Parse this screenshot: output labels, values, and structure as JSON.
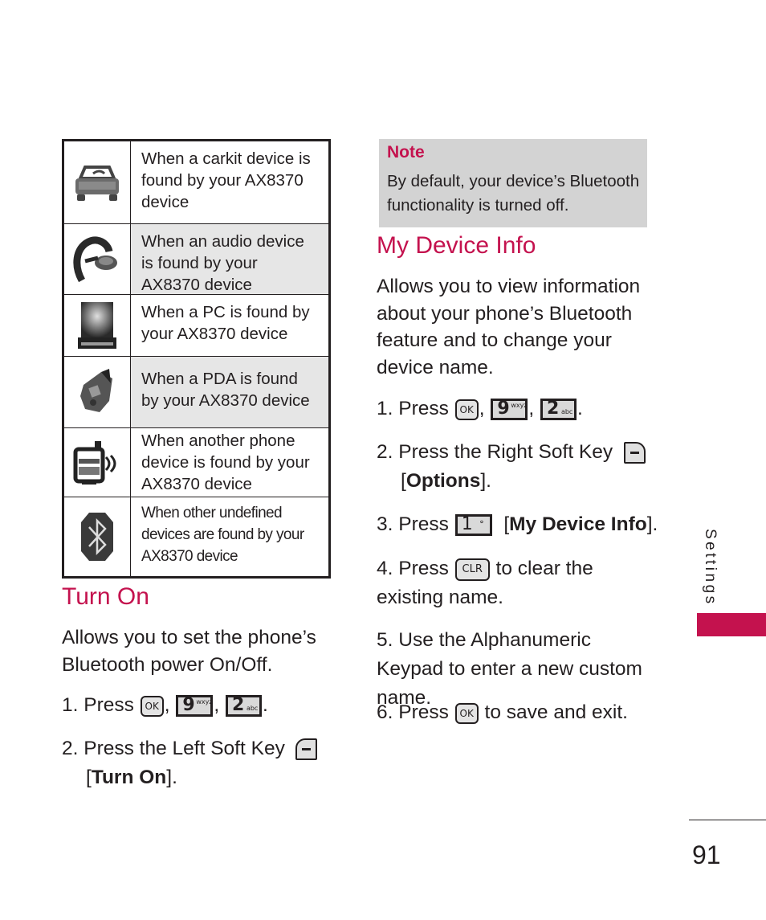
{
  "device_table": {
    "rows": [
      {
        "icon": "carkit-icon",
        "text": "When a carkit device is found by your AX8370 device"
      },
      {
        "icon": "audio-headset-icon",
        "text": "When an audio device is found by your AX8370 device"
      },
      {
        "icon": "pc-icon",
        "text": "When a PC is found by your AX8370 device"
      },
      {
        "icon": "pda-icon",
        "text": "When a PDA is found by your AX8370 device"
      },
      {
        "icon": "phone-icon",
        "text": "When another phone device is found by your AX8370 device"
      },
      {
        "icon": "bluetooth-icon",
        "text": "When other undefined devices are found by your AX8370 device"
      }
    ]
  },
  "turn_on": {
    "heading": "Turn On",
    "description": "Allows you to set the phone’s Bluetooth power On/Off.",
    "steps": [
      {
        "number": "1.",
        "text_before": "Press",
        "keys": [
          "OK",
          "9 wxyz",
          "2 abc"
        ],
        "text_after": "."
      },
      {
        "number": "2.",
        "text_before": "Press the Left Soft Key",
        "key": "left-soft-key",
        "option": "Turn On"
      }
    ]
  },
  "note": {
    "title": "Note",
    "body": "By default, your device’s Bluetooth functionality is turned off."
  },
  "my_device_info": {
    "heading": "My Device Info",
    "description": "Allows you to view information about your phone’s Bluetooth feature and to change your device name.",
    "steps": [
      {
        "number": "1.",
        "text_before": "Press",
        "keys": [
          "OK",
          "9 wxyz",
          "2 abc"
        ],
        "text_after": "."
      },
      {
        "number": "2.",
        "text_before": "Press the Right Soft Key",
        "key": "right-soft-key",
        "option": "Options"
      },
      {
        "number": "3.",
        "text_before": "Press",
        "key": "1",
        "option": "My Device Info"
      },
      {
        "number": "4.",
        "text_before": "Press",
        "key": "CLR",
        "text_after": "to clear the existing name."
      },
      {
        "number": "5.",
        "text": "Use the Alphanumeric Keypad to enter a new custom name."
      },
      {
        "number": "6.",
        "text_before": "Press",
        "key": "OK",
        "text_after": "to save and exit."
      }
    ]
  },
  "keys": {
    "ok": "OK",
    "nine": "9",
    "nine_letters": "wxyz",
    "two": "2",
    "two_letters": "abc",
    "one": "1",
    "clr": "CLR"
  },
  "punct": {
    "comma": ",",
    "period": ".",
    "lbracket": "[",
    "rbracket_period": "]."
  },
  "side_tab": {
    "label": "Settings",
    "accent_color": "#c4124e"
  },
  "page_number": "91"
}
